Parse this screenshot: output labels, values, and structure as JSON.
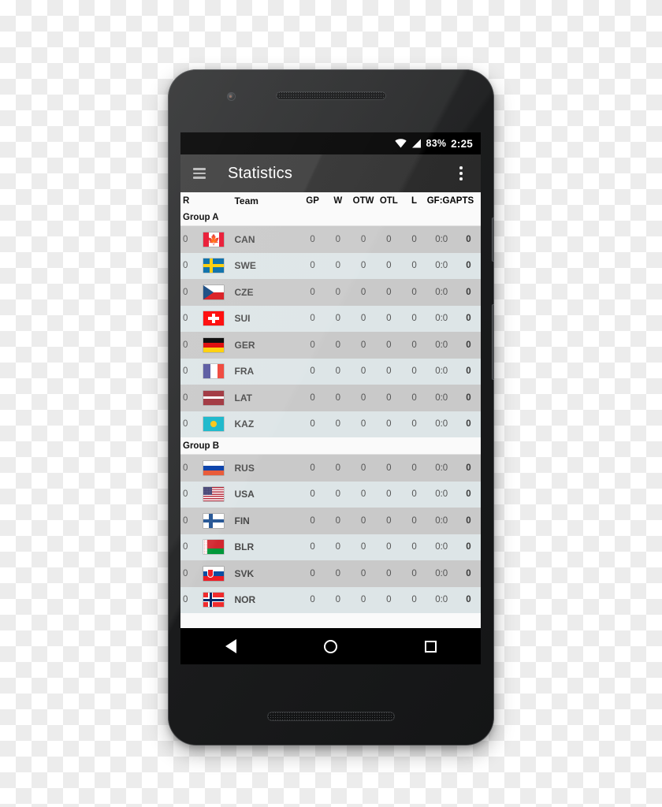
{
  "status_bar": {
    "wifi_icon": "wifi-icon",
    "signal_icon": "cellular-signal-icon",
    "battery": "83%",
    "clock": "2:25"
  },
  "toolbar": {
    "menu_icon": "hamburger-menu-icon",
    "title": "Statistics",
    "overflow_icon": "overflow-menu-icon"
  },
  "table": {
    "headers": {
      "rank": "R",
      "team": "Team",
      "gp": "GP",
      "w": "W",
      "otw": "OTW",
      "otl": "OTL",
      "l": "L",
      "gfga": "GF:GA",
      "pts": "PTS"
    },
    "groups": [
      {
        "label": "Group A",
        "rows": [
          {
            "rank": "0",
            "code": "CAN",
            "flag": "flag-canada",
            "gp": "0",
            "w": "0",
            "otw": "0",
            "otl": "0",
            "l": "0",
            "gfga": "0:0",
            "pts": "0"
          },
          {
            "rank": "0",
            "code": "SWE",
            "flag": "flag-sweden",
            "gp": "0",
            "w": "0",
            "otw": "0",
            "otl": "0",
            "l": "0",
            "gfga": "0:0",
            "pts": "0"
          },
          {
            "rank": "0",
            "code": "CZE",
            "flag": "flag-czech-republic",
            "gp": "0",
            "w": "0",
            "otw": "0",
            "otl": "0",
            "l": "0",
            "gfga": "0:0",
            "pts": "0"
          },
          {
            "rank": "0",
            "code": "SUI",
            "flag": "flag-switzerland",
            "gp": "0",
            "w": "0",
            "otw": "0",
            "otl": "0",
            "l": "0",
            "gfga": "0:0",
            "pts": "0"
          },
          {
            "rank": "0",
            "code": "GER",
            "flag": "flag-germany",
            "gp": "0",
            "w": "0",
            "otw": "0",
            "otl": "0",
            "l": "0",
            "gfga": "0:0",
            "pts": "0"
          },
          {
            "rank": "0",
            "code": "FRA",
            "flag": "flag-france",
            "gp": "0",
            "w": "0",
            "otw": "0",
            "otl": "0",
            "l": "0",
            "gfga": "0:0",
            "pts": "0"
          },
          {
            "rank": "0",
            "code": "LAT",
            "flag": "flag-latvia",
            "gp": "0",
            "w": "0",
            "otw": "0",
            "otl": "0",
            "l": "0",
            "gfga": "0:0",
            "pts": "0"
          },
          {
            "rank": "0",
            "code": "KAZ",
            "flag": "flag-kazakhstan",
            "gp": "0",
            "w": "0",
            "otw": "0",
            "otl": "0",
            "l": "0",
            "gfga": "0:0",
            "pts": "0"
          }
        ]
      },
      {
        "label": "Group B",
        "rows": [
          {
            "rank": "0",
            "code": "RUS",
            "flag": "flag-russia",
            "gp": "0",
            "w": "0",
            "otw": "0",
            "otl": "0",
            "l": "0",
            "gfga": "0:0",
            "pts": "0"
          },
          {
            "rank": "0",
            "code": "USA",
            "flag": "flag-usa",
            "gp": "0",
            "w": "0",
            "otw": "0",
            "otl": "0",
            "l": "0",
            "gfga": "0:0",
            "pts": "0"
          },
          {
            "rank": "0",
            "code": "FIN",
            "flag": "flag-finland",
            "gp": "0",
            "w": "0",
            "otw": "0",
            "otl": "0",
            "l": "0",
            "gfga": "0:0",
            "pts": "0"
          },
          {
            "rank": "0",
            "code": "BLR",
            "flag": "flag-belarus",
            "gp": "0",
            "w": "0",
            "otw": "0",
            "otl": "0",
            "l": "0",
            "gfga": "0:0",
            "pts": "0"
          },
          {
            "rank": "0",
            "code": "SVK",
            "flag": "flag-slovakia",
            "gp": "0",
            "w": "0",
            "otw": "0",
            "otl": "0",
            "l": "0",
            "gfga": "0:0",
            "pts": "0"
          },
          {
            "rank": "0",
            "code": "NOR",
            "flag": "flag-norway",
            "gp": "0",
            "w": "0",
            "otw": "0",
            "otl": "0",
            "l": "0",
            "gfga": "0:0",
            "pts": "0"
          }
        ]
      }
    ]
  },
  "nav_bar": {
    "back_icon": "back-triangle-icon",
    "home_icon": "home-circle-icon",
    "recents_icon": "recents-square-icon"
  },
  "colors": {
    "toolbar": "#3a3a3a",
    "row_odd": "#c9c9c9",
    "row_even": "#dde5e7",
    "header_bg": "#fafafa"
  }
}
